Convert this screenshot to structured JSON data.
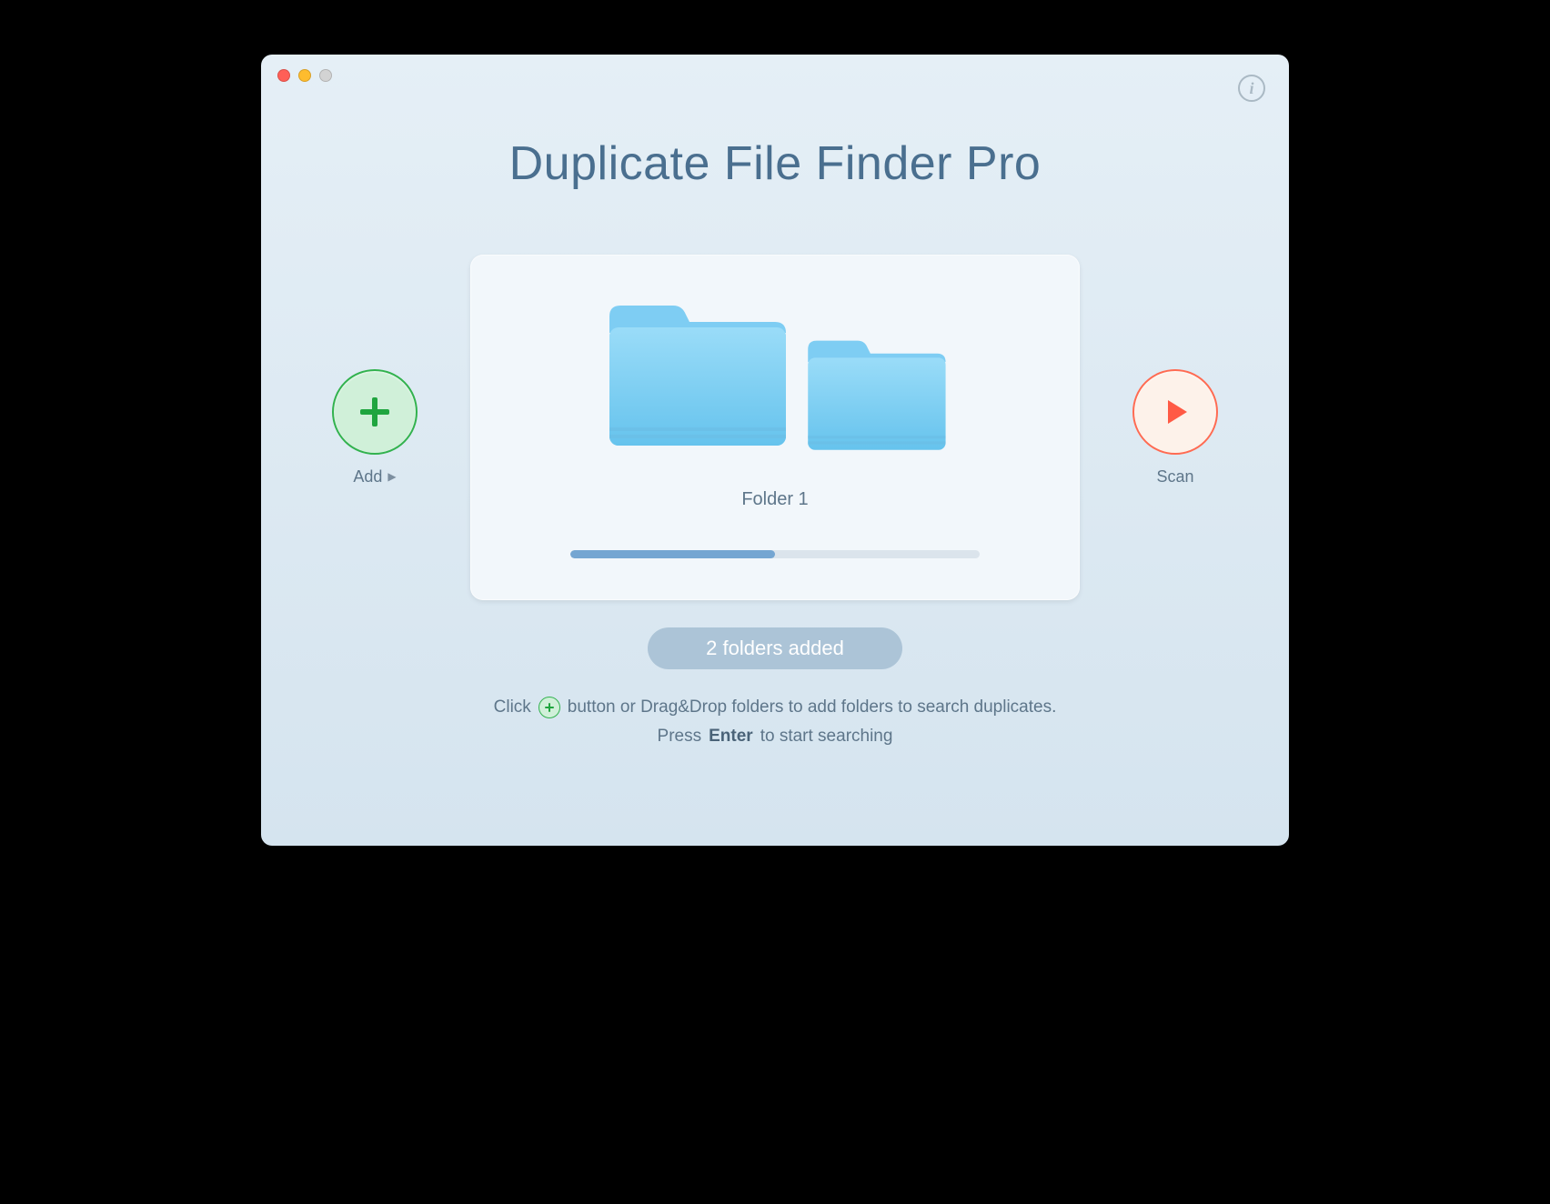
{
  "app": {
    "title": "Duplicate File Finder Pro"
  },
  "controls": {
    "add_label": "Add",
    "scan_label": "Scan"
  },
  "drop": {
    "folder_label": "Folder 1",
    "progress_percent": 50
  },
  "status": {
    "text": "2 folders added"
  },
  "hints": {
    "line1_prefix": "Click",
    "line1_suffix": "button or Drag&Drop folders to add folders to search duplicates.",
    "line2_prefix": "Press",
    "line2_bold": "Enter",
    "line2_suffix": "to start searching"
  },
  "colors": {
    "accent_green": "#32b24e",
    "accent_red": "#ff6b52",
    "title": "#4a6f8f"
  }
}
